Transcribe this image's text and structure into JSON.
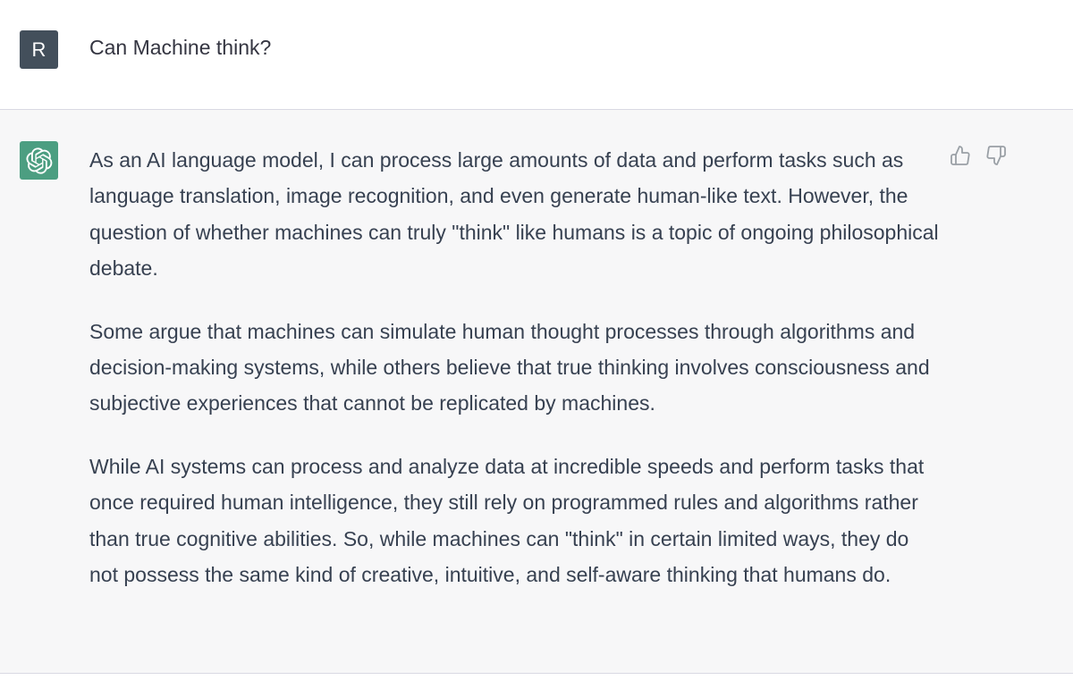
{
  "user": {
    "avatar_letter": "R",
    "message": "Can Machine think?"
  },
  "assistant": {
    "avatar_icon": "openai-logo-icon",
    "paragraphs": [
      "As an AI language model, I can process large amounts of data and perform tasks such as language translation, image recognition, and even generate human-like text. However, the question of whether machines can truly \"think\" like humans is a topic of ongoing philosophical debate.",
      "Some argue that machines can simulate human thought processes through algorithms and decision-making systems, while others believe that true thinking involves consciousness and subjective experiences that cannot be replicated by machines.",
      "While AI systems can process and analyze data at incredible speeds and perform tasks that once required human intelligence, they still rely on programmed rules and algorithms rather than true cognitive abilities. So, while machines can \"think\" in certain limited ways, they do not possess the same kind of creative, intuitive, and self-aware thinking that humans do."
    ],
    "feedback": {
      "thumbs_up_icon": "thumbs-up-icon",
      "thumbs_down_icon": "thumbs-down-icon"
    }
  },
  "colors": {
    "user_avatar_bg": "#434f5b",
    "assistant_avatar_bg": "#4c9e81",
    "assistant_row_bg": "#f7f7f8",
    "text": "#374151",
    "border": "#d9d9e3"
  }
}
